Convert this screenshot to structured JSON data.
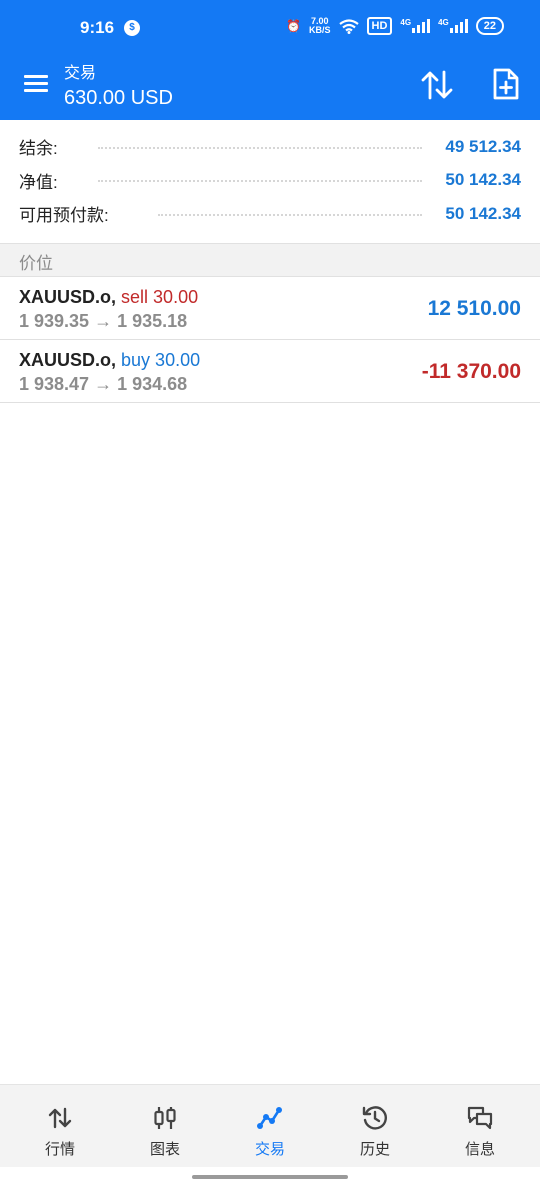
{
  "status_bar": {
    "time": "9:16",
    "speed_value": "7.00",
    "speed_unit": "KB/S",
    "hd_label": "HD",
    "net1": "4G",
    "net2": "4G",
    "battery": "22"
  },
  "app_bar": {
    "title": "交易",
    "balance_currency": "630.00 USD",
    "icons": [
      "menu-icon",
      "sort-icon",
      "new-order-icon"
    ]
  },
  "account": {
    "balance_label": "结余:",
    "balance_value": "49 512.34",
    "equity_label": "净值:",
    "equity_value": "50 142.34",
    "free_margin_label": "可用预付款:",
    "free_margin_value": "50 142.34"
  },
  "section": {
    "title": "价位"
  },
  "positions": [
    {
      "symbol": "XAUUSD.o,",
      "side": "sell 30.00",
      "prices": "1 939.35 → 1 935.18",
      "profit": "12 510.00"
    },
    {
      "symbol": "XAUUSD.o,",
      "side": "buy 30.00",
      "prices": "1 938.47 → 1 934.68",
      "profit": "-11 370.00"
    }
  ],
  "bottom_nav": [
    {
      "label": "行情",
      "icon": "quotes-icon"
    },
    {
      "label": "图表",
      "icon": "chart-icon"
    },
    {
      "label": "交易",
      "icon": "trade-icon"
    },
    {
      "label": "历史",
      "icon": "history-icon"
    },
    {
      "label": "信息",
      "icon": "messages-icon"
    }
  ],
  "colors": {
    "primary": "#1479f4",
    "value_blue": "#1a78d4",
    "loss_red": "#c12a2a"
  }
}
